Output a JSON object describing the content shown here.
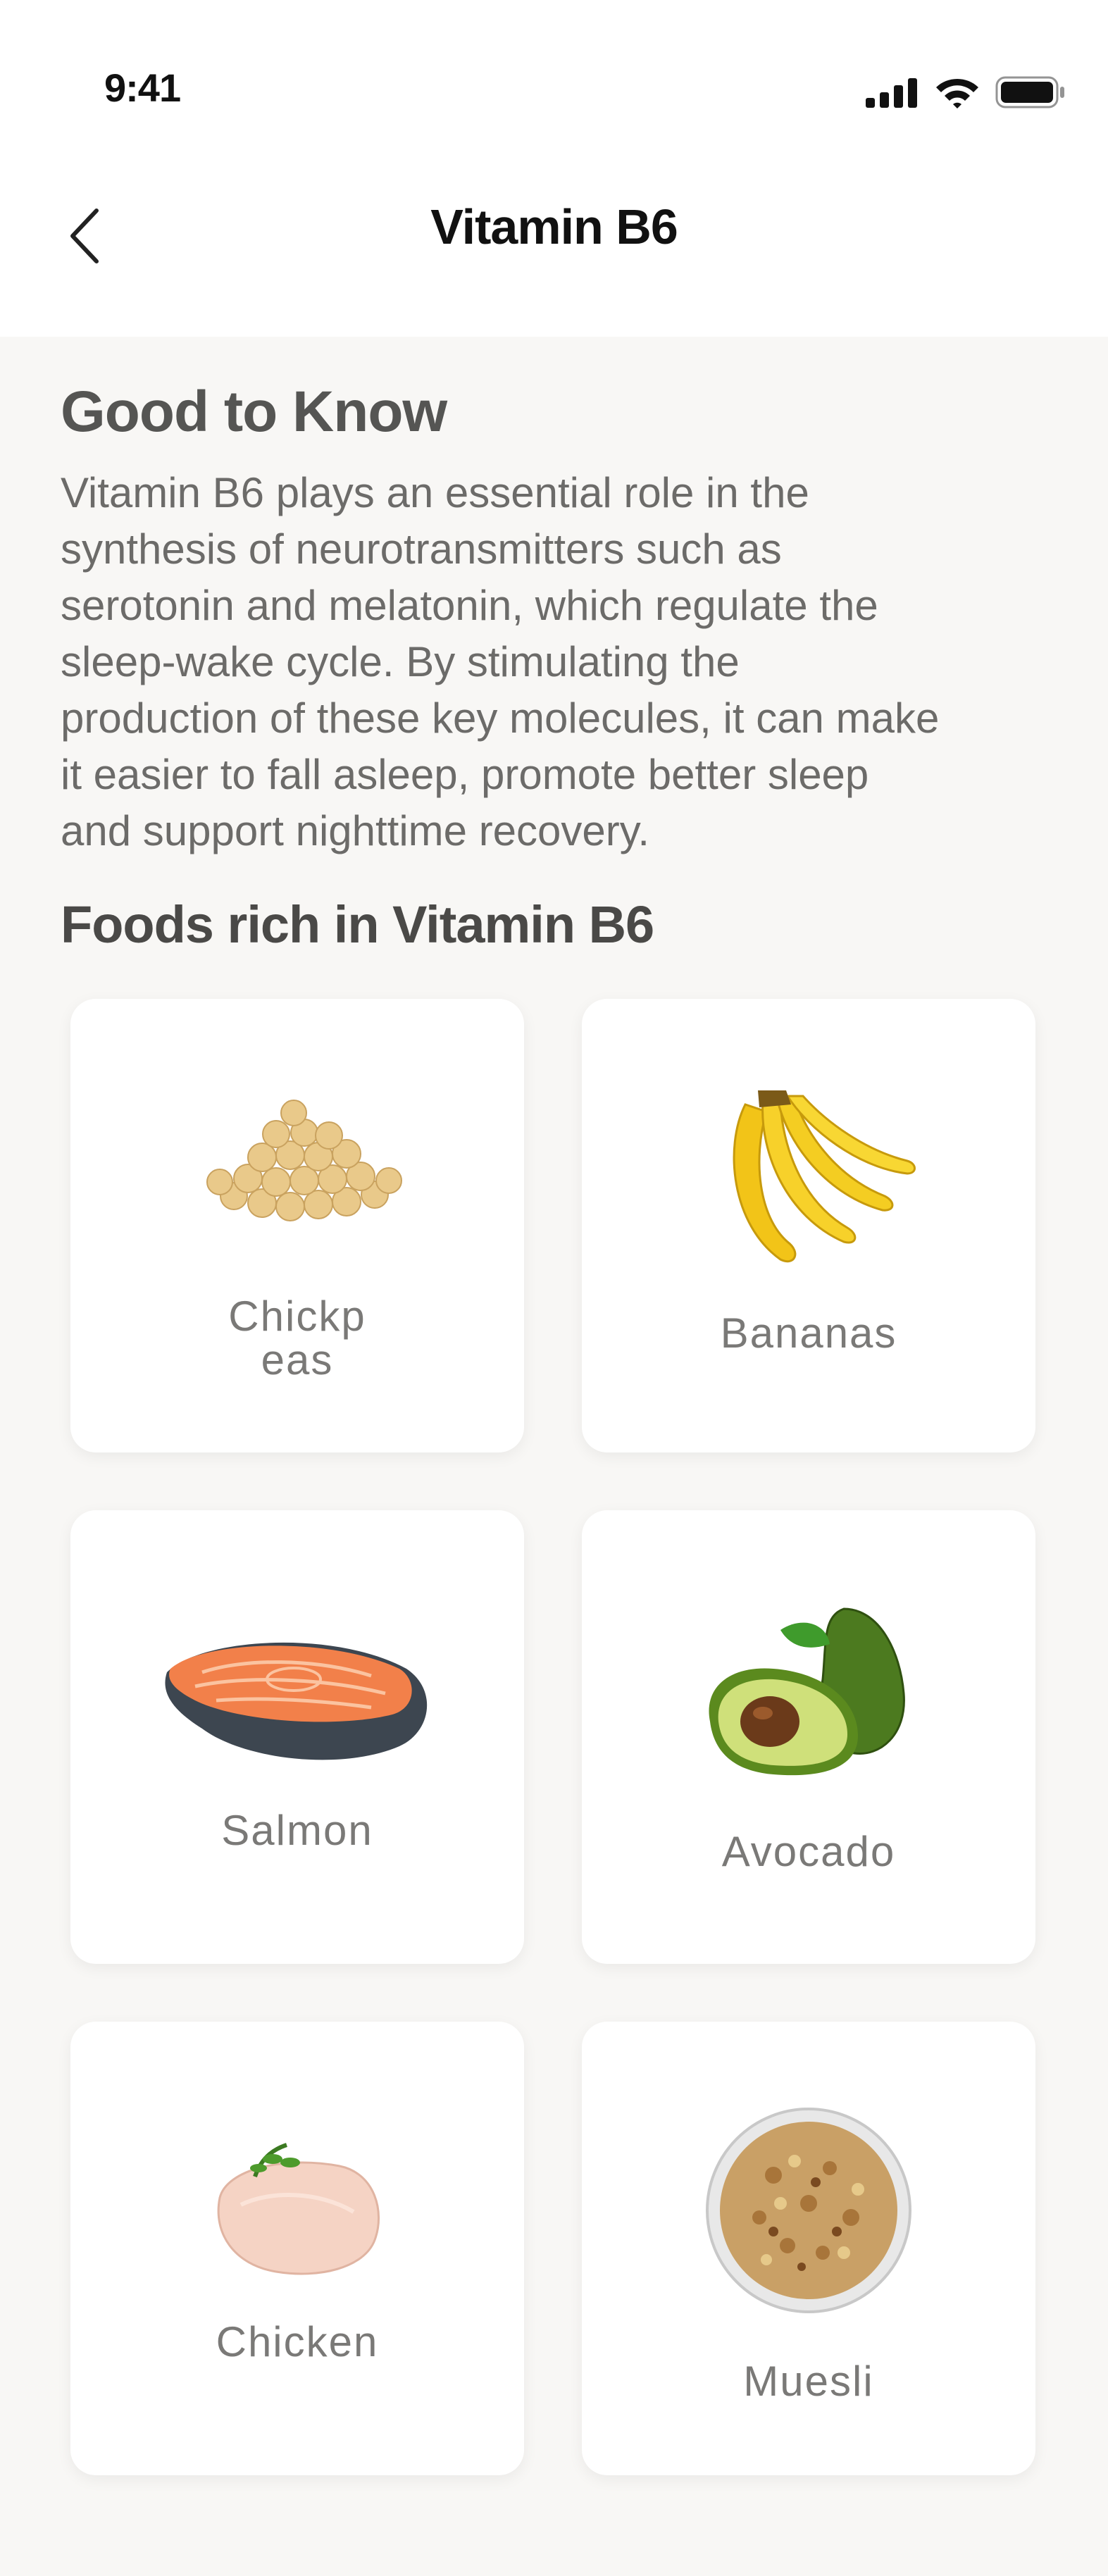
{
  "status_bar": {
    "time": "9:41"
  },
  "header": {
    "title": "Vitamin B6",
    "back_icon": "chevron-left-icon"
  },
  "info": {
    "title": "Good to Know",
    "lines": [
      "Vitamin B6 plays an essential role in the",
      "synthesis of neurotransmitters such as",
      "serotonin and melatonin, which regulate the",
      "sleep-wake cycle. By stimulating the",
      "production of these key molecules, it can make",
      "it easier to fall asleep, promote better sleep",
      "and support nighttime recovery."
    ]
  },
  "foods": {
    "title": "Foods rich in Vitamin B6",
    "items": [
      {
        "name_line1": "Chickp",
        "name_line2": "eas",
        "icon": "chickpeas-image"
      },
      {
        "name_line1": "Bananas",
        "icon": "bananas-image"
      },
      {
        "name_line1": "Salmon",
        "icon": "salmon-image"
      },
      {
        "name_line1": "Avocado",
        "icon": "avocado-image"
      },
      {
        "name_line1": "Chicken",
        "icon": "chicken-image"
      },
      {
        "name_line1": "Muesli",
        "icon": "muesli-image"
      }
    ]
  }
}
